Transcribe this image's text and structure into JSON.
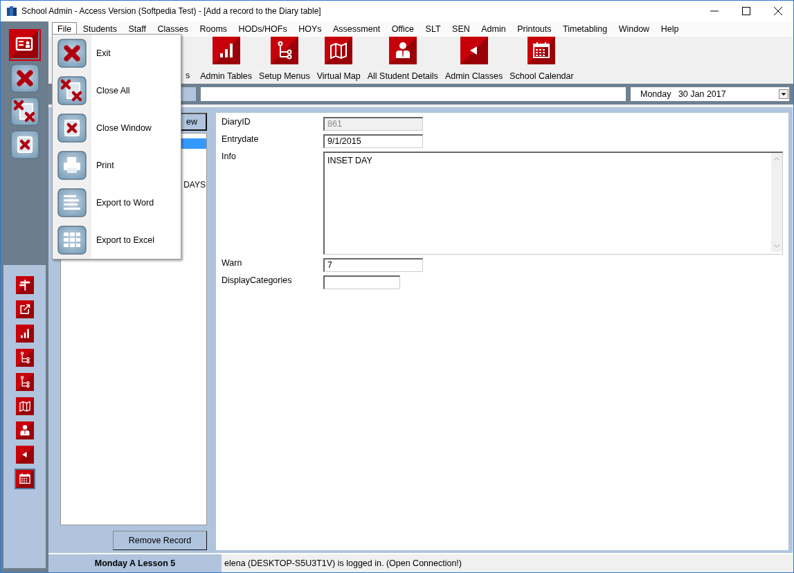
{
  "window": {
    "title": "School Admin - Access Version (Softpedia Test) - [Add a record to the Diary table]"
  },
  "menu_bar": [
    {
      "label": "File",
      "selected": true
    },
    {
      "label": "Students",
      "selected": false
    },
    {
      "label": "Staff",
      "selected": false
    },
    {
      "label": "Classes",
      "selected": false
    },
    {
      "label": "Rooms",
      "selected": false
    },
    {
      "label": "HODs/HOFs",
      "selected": false
    },
    {
      "label": "HOYs",
      "selected": false
    },
    {
      "label": "Assessment",
      "selected": false
    },
    {
      "label": "Office",
      "selected": false
    },
    {
      "label": "SLT",
      "selected": false
    },
    {
      "label": "SEN",
      "selected": false
    },
    {
      "label": "Admin",
      "selected": false
    },
    {
      "label": "Printouts",
      "selected": false
    },
    {
      "label": "Timetabling",
      "selected": false
    },
    {
      "label": "Window",
      "selected": false
    },
    {
      "label": "Help",
      "selected": false
    }
  ],
  "file_menu": [
    {
      "label": "Exit"
    },
    {
      "label": "Close All"
    },
    {
      "label": "Close Window"
    },
    {
      "label": "Print"
    },
    {
      "label": "Export to Word"
    },
    {
      "label": "Export to Excel"
    }
  ],
  "toolbar": [
    {
      "kind": "cut",
      "label": "s"
    },
    {
      "kind": "tile",
      "label": "Admin Tables"
    },
    {
      "kind": "tile",
      "label": "Setup Menus"
    },
    {
      "kind": "tile",
      "label": "Virtual Map"
    },
    {
      "kind": "tile",
      "label": "All Student Details"
    },
    {
      "kind": "tile",
      "label": "Admin Classes"
    },
    {
      "kind": "tile",
      "label": "School Calendar"
    }
  ],
  "date_picker": {
    "value": "Monday   30 Jan 2017"
  },
  "side_buttons": [
    {
      "selected": true
    },
    {
      "selected": false
    },
    {
      "selected": false
    },
    {
      "selected": false
    }
  ],
  "quick_launch": [
    {
      "selected": false
    },
    {
      "selected": false
    },
    {
      "selected": false
    },
    {
      "selected": false
    },
    {
      "selected": false
    },
    {
      "selected": false
    },
    {
      "selected": false
    },
    {
      "selected": false
    },
    {
      "selected": true
    }
  ],
  "list_panel": {
    "button": "ew",
    "rows": [
      {
        "selected": true
      },
      {
        "text": "DAYS",
        "selected": false
      }
    ],
    "remove_button": "Remove Record"
  },
  "form": [
    {
      "label": "DiaryID",
      "value": "861",
      "kind": "short",
      "disabled": true
    },
    {
      "label": "Entrydate",
      "value": "9/1/2015",
      "kind": "short",
      "disabled": false
    },
    {
      "label": "Info",
      "value": "INSET DAY",
      "kind": "memo",
      "disabled": false
    },
    {
      "label": "Warn",
      "value": "7",
      "kind": "short",
      "disabled": false
    },
    {
      "label": "DisplayCategories",
      "kind": "narrow",
      "disabled": false
    }
  ],
  "status_bar": {
    "lesson": "Monday A Lesson 5",
    "message": "elena (DESKTOP-S5U3T1V) is logged in. (Open Connection!)"
  }
}
